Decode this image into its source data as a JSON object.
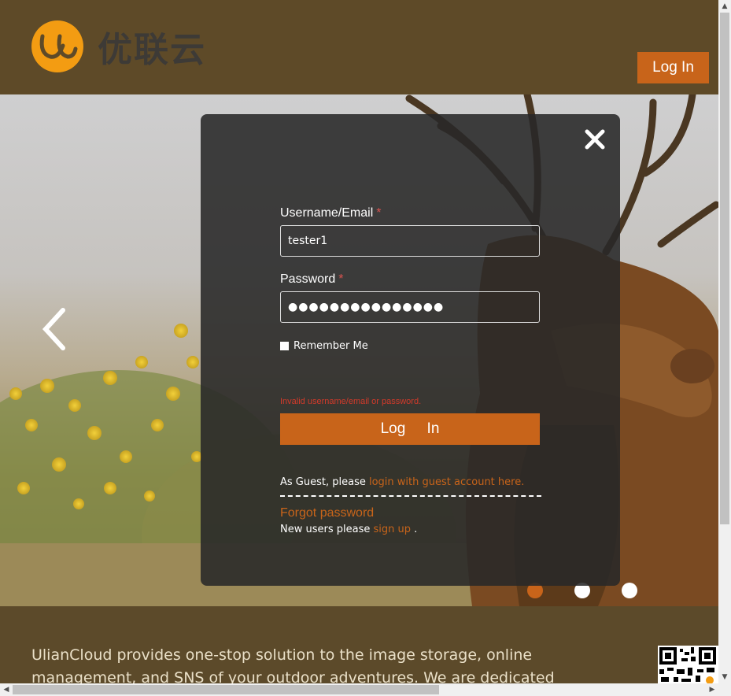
{
  "header": {
    "logo_text": "优联云",
    "login_label": "Log In"
  },
  "modal": {
    "username_label": "Username/Email",
    "username_value": "tester1",
    "password_label": "Password",
    "password_masked": "●●●●●●●●●●●●●●●",
    "required_mark": "*",
    "remember_label": "Remember Me",
    "error_text": "Invalid username/email or password.",
    "login_button": "Log In",
    "guest_prefix": "As Guest, please",
    "guest_link": "login with guest account here.",
    "forgot_link": "Forgot password",
    "new_users_prefix": "New users please",
    "signup_link": "sign up",
    "new_users_suffix": "."
  },
  "about": {
    "text": "UlianCloud provides one-stop solution  to  the image storage,  online management,  and SNS of your outdoor adventures.  We are dedicated to"
  },
  "colors": {
    "accent": "#c8641a",
    "header_bg": "#5e4a28",
    "logo_orange": "#f39c12"
  }
}
